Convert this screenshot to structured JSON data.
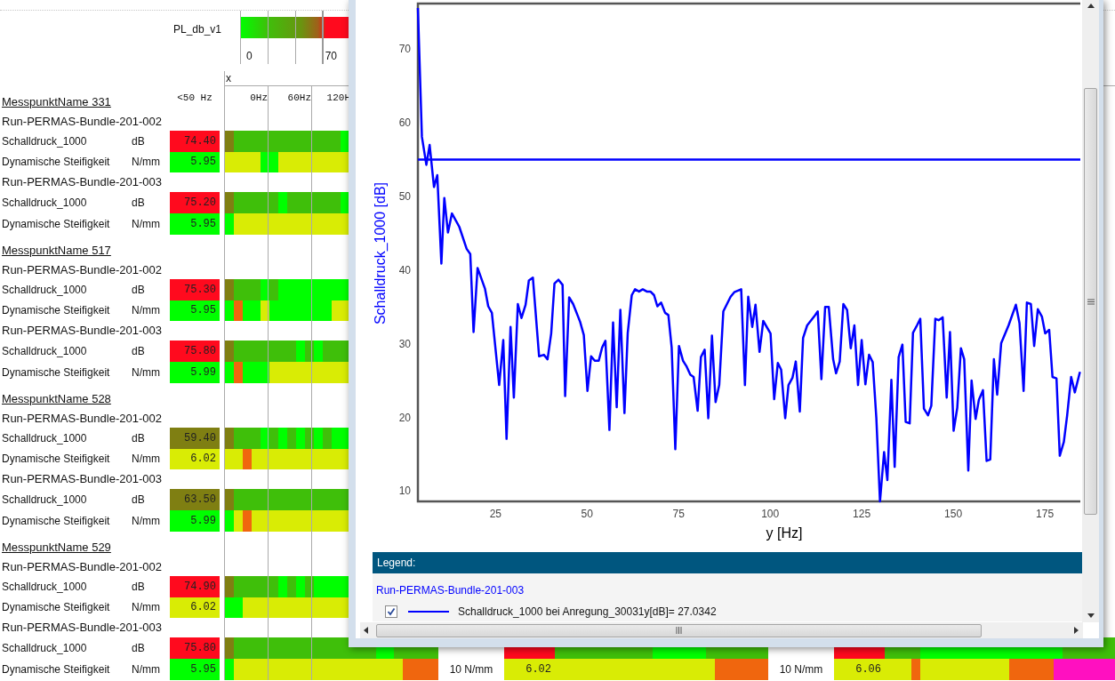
{
  "color_scale": {
    "label": "PL_db_v1",
    "ticks": [
      "0",
      "70"
    ]
  },
  "axis_label": "x",
  "columns": [
    "<50 Hz",
    "0Hz",
    "60Hz",
    "120H"
  ],
  "groups": [
    {
      "title": "MesspunktName 331",
      "runs": [
        {
          "name": "Run-PERMAS-Bundle-201-002",
          "rows": [
            {
              "label": "Schalldruck_1000",
              "unit": "dB",
              "value": "74.40",
              "color": "#ff0a1e",
              "cells": [
                {
                  "color": "#7f7f12"
                },
                {
                  "color": "#3fbf0a"
                },
                {
                  "color": "#3fbf0a"
                },
                {
                  "color": "#3fbf0a"
                },
                {
                  "color": "#3fbf0a"
                },
                {
                  "color": "#3fbf0a"
                },
                {
                  "color": "#3fbf0a"
                },
                {
                  "color": "#3fbf0a"
                },
                {
                  "color": "#3fbf0a"
                },
                {
                  "color": "#3fbf0a"
                },
                {
                  "color": "#3fbf0a"
                },
                {
                  "color": "#3fbf0a"
                },
                {
                  "color": "#3fbf0a"
                },
                {
                  "color": "#00ff00"
                }
              ]
            },
            {
              "label": "Dynamische Steifigkeit",
              "unit": "N/mm",
              "value": "5.95",
              "color": "#00ff00",
              "cells": [
                {
                  "color": "#d9ec05"
                },
                {
                  "color": "#d9ec05"
                },
                {
                  "color": "#d9ec05"
                },
                {
                  "color": "#d9ec05"
                },
                {
                  "color": "#00ff00"
                },
                {
                  "color": "#00ff00"
                },
                {
                  "color": "#d9ec05"
                },
                {
                  "color": "#d9ec05"
                },
                {
                  "color": "#d9ec05"
                },
                {
                  "color": "#d9ec05"
                },
                {
                  "color": "#d9ec05"
                },
                {
                  "color": "#d9ec05"
                },
                {
                  "color": "#d9ec05"
                },
                {
                  "color": "#d9ec05"
                }
              ]
            }
          ]
        },
        {
          "name": "Run-PERMAS-Bundle-201-003",
          "rows": [
            {
              "label": "Schalldruck_1000",
              "unit": "dB",
              "value": "75.20",
              "color": "#ff0a1e",
              "cells": [
                {
                  "color": "#7f7f12"
                },
                {
                  "color": "#3fbf0a"
                },
                {
                  "color": "#3fbf0a"
                },
                {
                  "color": "#3fbf0a"
                },
                {
                  "color": "#3fbf0a"
                },
                {
                  "color": "#3fbf0a"
                },
                {
                  "color": "#00ff00"
                },
                {
                  "color": "#3fbf0a"
                },
                {
                  "color": "#3fbf0a"
                },
                {
                  "color": "#3fbf0a"
                },
                {
                  "color": "#3fbf0a"
                },
                {
                  "color": "#3fbf0a"
                },
                {
                  "color": "#3fbf0a"
                },
                {
                  "color": "#00ff00"
                }
              ]
            },
            {
              "label": "Dynamische Steifigkeit",
              "unit": "N/mm",
              "value": "5.95",
              "color": "#00ff00",
              "cells": [
                {
                  "color": "#00ff00"
                },
                {
                  "color": "#d9ec05"
                },
                {
                  "color": "#d9ec05"
                },
                {
                  "color": "#d9ec05"
                },
                {
                  "color": "#d9ec05"
                },
                {
                  "color": "#d9ec05"
                },
                {
                  "color": "#d9ec05"
                },
                {
                  "color": "#d9ec05"
                },
                {
                  "color": "#d9ec05"
                },
                {
                  "color": "#d9ec05"
                },
                {
                  "color": "#d9ec05"
                },
                {
                  "color": "#d9ec05"
                },
                {
                  "color": "#d9ec05"
                },
                {
                  "color": "#d9ec05"
                }
              ]
            }
          ]
        }
      ]
    },
    {
      "title": "MesspunktName 517",
      "runs": [
        {
          "name": "Run-PERMAS-Bundle-201-002",
          "rows": [
            {
              "label": "Schalldruck_1000",
              "unit": "dB",
              "value": "75.30",
              "color": "#ff0a1e",
              "cells": [
                {
                  "color": "#7f7f12"
                },
                {
                  "color": "#3fbf0a"
                },
                {
                  "color": "#3fbf0a"
                },
                {
                  "color": "#3fbf0a"
                },
                {
                  "color": "#00ff00"
                },
                {
                  "color": "#3fbf0a"
                },
                {
                  "color": "#00ff00"
                },
                {
                  "color": "#00ff00"
                },
                {
                  "color": "#00ff00"
                },
                {
                  "color": "#00ff00"
                },
                {
                  "color": "#00ff00"
                },
                {
                  "color": "#00ff00"
                },
                {
                  "color": "#00ff00"
                },
                {
                  "color": "#00ff00"
                }
              ]
            },
            {
              "label": "Dynamische Steifigkeit",
              "unit": "N/mm",
              "value": "5.95",
              "color": "#00ff00",
              "cells": [
                {
                  "color": "#00ff00"
                },
                {
                  "color": "#f0660e"
                },
                {
                  "color": "#00ff00"
                },
                {
                  "color": "#00ff00"
                },
                {
                  "color": "#d9ec05"
                },
                {
                  "color": "#00ff00"
                },
                {
                  "color": "#00ff00"
                },
                {
                  "color": "#00ff00"
                },
                {
                  "color": "#00ff00"
                },
                {
                  "color": "#00ff00"
                },
                {
                  "color": "#00ff00"
                },
                {
                  "color": "#00ff00"
                },
                {
                  "color": "#d9ec05"
                },
                {
                  "color": "#d9ec05"
                }
              ]
            }
          ]
        },
        {
          "name": "Run-PERMAS-Bundle-201-003",
          "rows": [
            {
              "label": "Schalldruck_1000",
              "unit": "dB",
              "value": "75.80",
              "color": "#ff0a1e",
              "cells": [
                {
                  "color": "#7f7f12"
                },
                {
                  "color": "#3fbf0a"
                },
                {
                  "color": "#3fbf0a"
                },
                {
                  "color": "#3fbf0a"
                },
                {
                  "color": "#3fbf0a"
                },
                {
                  "color": "#3fbf0a"
                },
                {
                  "color": "#3fbf0a"
                },
                {
                  "color": "#3fbf0a"
                },
                {
                  "color": "#00ff00"
                },
                {
                  "color": "#3fbf0a"
                },
                {
                  "color": "#00ff00"
                },
                {
                  "color": "#3fbf0a"
                },
                {
                  "color": "#3fbf0a"
                },
                {
                  "color": "#3fbf0a"
                }
              ]
            },
            {
              "label": "Dynamische Steifigkeit",
              "unit": "N/mm",
              "value": "5.99",
              "color": "#00ff00",
              "cells": [
                {
                  "color": "#00ff00"
                },
                {
                  "color": "#f0660e"
                },
                {
                  "color": "#00ff00"
                },
                {
                  "color": "#00ff00"
                },
                {
                  "color": "#00ff00"
                },
                {
                  "color": "#d9ec05"
                },
                {
                  "color": "#d9ec05"
                },
                {
                  "color": "#d9ec05"
                },
                {
                  "color": "#d9ec05"
                },
                {
                  "color": "#d9ec05"
                },
                {
                  "color": "#d9ec05"
                },
                {
                  "color": "#d9ec05"
                },
                {
                  "color": "#d9ec05"
                },
                {
                  "color": "#d9ec05"
                }
              ]
            }
          ]
        }
      ]
    },
    {
      "title": "MesspunktName 528",
      "runs": [
        {
          "name": "Run-PERMAS-Bundle-201-002",
          "rows": [
            {
              "label": "Schalldruck_1000",
              "unit": "dB",
              "value": "59.40",
              "color": "#7f7f12",
              "cells": [
                {
                  "color": "#7f7f12"
                },
                {
                  "color": "#3fbf0a"
                },
                {
                  "color": "#3fbf0a"
                },
                {
                  "color": "#3fbf0a"
                },
                {
                  "color": "#00ff00"
                },
                {
                  "color": "#3fbf0a"
                },
                {
                  "color": "#00ff00"
                },
                {
                  "color": "#3fbf0a"
                },
                {
                  "color": "#00ff00"
                },
                {
                  "color": "#3fbf0a"
                },
                {
                  "color": "#00ff00"
                },
                {
                  "color": "#3fbf0a"
                },
                {
                  "color": "#00ff00"
                },
                {
                  "color": "#00ff00"
                }
              ]
            },
            {
              "label": "Dynamische Steifigkeit",
              "unit": "N/mm",
              "value": "6.02",
              "color": "#d9ec05",
              "cells": [
                {
                  "color": "#d9ec05"
                },
                {
                  "color": "#d9ec05"
                },
                {
                  "color": "#f0660e"
                },
                {
                  "color": "#d9ec05"
                },
                {
                  "color": "#d9ec05"
                },
                {
                  "color": "#d9ec05"
                },
                {
                  "color": "#d9ec05"
                },
                {
                  "color": "#d9ec05"
                },
                {
                  "color": "#d9ec05"
                },
                {
                  "color": "#d9ec05"
                },
                {
                  "color": "#d9ec05"
                },
                {
                  "color": "#d9ec05"
                },
                {
                  "color": "#d9ec05"
                },
                {
                  "color": "#d9ec05"
                }
              ]
            }
          ]
        },
        {
          "name": "Run-PERMAS-Bundle-201-003",
          "rows": [
            {
              "label": "Schalldruck_1000",
              "unit": "dB",
              "value": "63.50",
              "color": "#7f7f12",
              "cells": [
                {
                  "color": "#7f7f12"
                },
                {
                  "color": "#3fbf0a"
                },
                {
                  "color": "#3fbf0a"
                },
                {
                  "color": "#3fbf0a"
                },
                {
                  "color": "#3fbf0a"
                },
                {
                  "color": "#3fbf0a"
                },
                {
                  "color": "#3fbf0a"
                },
                {
                  "color": "#3fbf0a"
                },
                {
                  "color": "#3fbf0a"
                },
                {
                  "color": "#3fbf0a"
                },
                {
                  "color": "#3fbf0a"
                },
                {
                  "color": "#3fbf0a"
                },
                {
                  "color": "#3fbf0a"
                },
                {
                  "color": "#3fbf0a"
                }
              ]
            },
            {
              "label": "Dynamische Steifigkeit",
              "unit": "N/mm",
              "value": "5.99",
              "color": "#00ff00",
              "cells": [
                {
                  "color": "#00ff00"
                },
                {
                  "color": "#d9ec05"
                },
                {
                  "color": "#f0660e"
                },
                {
                  "color": "#d9ec05"
                },
                {
                  "color": "#d9ec05"
                },
                {
                  "color": "#d9ec05"
                },
                {
                  "color": "#d9ec05"
                },
                {
                  "color": "#d9ec05"
                },
                {
                  "color": "#d9ec05"
                },
                {
                  "color": "#d9ec05"
                },
                {
                  "color": "#d9ec05"
                },
                {
                  "color": "#d9ec05"
                },
                {
                  "color": "#d9ec05"
                },
                {
                  "color": "#d9ec05"
                }
              ]
            }
          ]
        }
      ]
    },
    {
      "title": "MesspunktName 529",
      "runs": [
        {
          "name": "Run-PERMAS-Bundle-201-002",
          "rows": [
            {
              "label": "Schalldruck_1000",
              "unit": "dB",
              "value": "74.90",
              "color": "#ff0a1e",
              "cells": [
                {
                  "color": "#7f7f12"
                },
                {
                  "color": "#3fbf0a"
                },
                {
                  "color": "#3fbf0a"
                },
                {
                  "color": "#3fbf0a"
                },
                {
                  "color": "#3fbf0a"
                },
                {
                  "color": "#3fbf0a"
                },
                {
                  "color": "#00ff00"
                },
                {
                  "color": "#3fbf0a"
                },
                {
                  "color": "#00ff00"
                },
                {
                  "color": "#3fbf0a"
                },
                {
                  "color": "#00ff00"
                },
                {
                  "color": "#00ff00"
                },
                {
                  "color": "#00ff00"
                },
                {
                  "color": "#00ff00"
                }
              ]
            },
            {
              "label": "Dynamische Steifigkeit",
              "unit": "N/mm",
              "value": "6.02",
              "color": "#d9ec05",
              "cells": [
                {
                  "color": "#00ff00"
                },
                {
                  "color": "#00ff00"
                },
                {
                  "color": "#d9ec05"
                },
                {
                  "color": "#d9ec05"
                },
                {
                  "color": "#d9ec05"
                },
                {
                  "color": "#d9ec05"
                },
                {
                  "color": "#d9ec05"
                },
                {
                  "color": "#d9ec05"
                },
                {
                  "color": "#d9ec05"
                },
                {
                  "color": "#d9ec05"
                },
                {
                  "color": "#d9ec05"
                },
                {
                  "color": "#d9ec05"
                },
                {
                  "color": "#d9ec05"
                },
                {
                  "color": "#d9ec05"
                }
              ]
            }
          ]
        },
        {
          "name": "Run-PERMAS-Bundle-201-003",
          "rows": [
            {
              "label": "Schalldruck_1000",
              "unit": "dB",
              "value": "75.80",
              "color": "#ff0a1e",
              "cells": [
                {
                  "color": "#7f7f12"
                },
                {
                  "color": "#3fbf0a"
                },
                {
                  "color": "#3fbf0a"
                },
                {
                  "color": "#3fbf0a"
                },
                {
                  "color": "#3fbf0a"
                },
                {
                  "color": "#3fbf0a"
                },
                {
                  "color": "#3fbf0a"
                },
                {
                  "color": "#3fbf0a"
                },
                {
                  "color": "#3fbf0a"
                },
                {
                  "color": "#3fbf0a"
                },
                {
                  "color": "#3fbf0a"
                },
                {
                  "color": "#3fbf0a"
                },
                {
                  "color": "#3fbf0a"
                },
                {
                  "color": "#3fbf0a"
                },
                {
                  "color": "#3fbf0a"
                },
                {
                  "color": "#3fbf0a"
                },
                {
                  "color": "#3fbf0a"
                },
                {
                  "color": "#00ff00"
                },
                {
                  "color": "#00ff00"
                },
                {
                  "color": "#3fbf0a"
                },
                {
                  "color": "#3fbf0a"
                },
                {
                  "color": "#3fbf0a"
                },
                {
                  "color": "#3fbf0a"
                },
                {
                  "color": "#3fbf0a"
                }
              ],
              "more": [
                {
                  "color": "#ff0a1e",
                  "cells": [
                    {
                      "color": "#3fbf0a"
                    },
                    {
                      "color": "#3fbf0a"
                    },
                    {
                      "color": "#3fbf0a"
                    },
                    {
                      "color": "#3fbf0a"
                    },
                    {
                      "color": "#3fbf0a"
                    },
                    {
                      "color": "#3fbf0a"
                    },
                    {
                      "color": "#3fbf0a"
                    },
                    {
                      "color": "#3fbf0a"
                    },
                    {
                      "color": "#3fbf0a"
                    },
                    {
                      "color": "#3fbf0a"
                    },
                    {
                      "color": "#3fbf0a"
                    },
                    {
                      "color": "#00ff00"
                    },
                    {
                      "color": "#00ff00"
                    },
                    {
                      "color": "#00ff00"
                    },
                    {
                      "color": "#00ff00"
                    },
                    {
                      "color": "#00ff00"
                    },
                    {
                      "color": "#00ff00"
                    },
                    {
                      "color": "#3fbf0a"
                    },
                    {
                      "color": "#3fbf0a"
                    },
                    {
                      "color": "#3fbf0a"
                    },
                    {
                      "color": "#3fbf0a"
                    },
                    {
                      "color": "#3fbf0a"
                    },
                    {
                      "color": "#3fbf0a"
                    },
                    {
                      "color": "#3fbf0a"
                    }
                  ]
                },
                {
                  "color": "#ff0a1e",
                  "cells": [
                    {
                      "color": "#3fbf0a"
                    },
                    {
                      "color": "#3fbf0a"
                    },
                    {
                      "color": "#3fbf0a"
                    },
                    {
                      "color": "#3fbf0a"
                    },
                    {
                      "color": "#00ff00"
                    },
                    {
                      "color": "#00ff00"
                    },
                    {
                      "color": "#00ff00"
                    },
                    {
                      "color": "#00ff00"
                    },
                    {
                      "color": "#00ff00"
                    },
                    {
                      "color": "#00ff00"
                    },
                    {
                      "color": "#00ff00"
                    },
                    {
                      "color": "#00ff00"
                    },
                    {
                      "color": "#00ff00"
                    },
                    {
                      "color": "#00ff00"
                    },
                    {
                      "color": "#00ff00"
                    },
                    {
                      "color": "#00ff00"
                    },
                    {
                      "color": "#00ff00"
                    },
                    {
                      "color": "#00ff00"
                    },
                    {
                      "color": "#00ff00"
                    },
                    {
                      "color": "#00ff00"
                    },
                    {
                      "color": "#3fbf0a"
                    },
                    {
                      "color": "#3fbf0a"
                    },
                    {
                      "color": "#3fbf0a"
                    },
                    {
                      "color": "#3fbf0a"
                    },
                    {
                      "color": "#3fbf0a"
                    },
                    {
                      "color": "#3fbf0a"
                    }
                  ]
                }
              ]
            },
            {
              "label": "Dynamische Steifigkeit",
              "unit": "N/mm",
              "value": "5.95",
              "color": "#00ff00",
              "cells": [
                {
                  "color": "#00ff00"
                },
                {
                  "color": "#d9ec05"
                },
                {
                  "color": "#d9ec05"
                },
                {
                  "color": "#d9ec05"
                },
                {
                  "color": "#d9ec05"
                },
                {
                  "color": "#d9ec05"
                },
                {
                  "color": "#d9ec05"
                },
                {
                  "color": "#d9ec05"
                },
                {
                  "color": "#d9ec05"
                },
                {
                  "color": "#d9ec05"
                },
                {
                  "color": "#d9ec05"
                },
                {
                  "color": "#d9ec05"
                },
                {
                  "color": "#d9ec05"
                },
                {
                  "color": "#d9ec05"
                },
                {
                  "color": "#d9ec05"
                },
                {
                  "color": "#d9ec05"
                },
                {
                  "color": "#d9ec05"
                },
                {
                  "color": "#d9ec05"
                },
                {
                  "color": "#d9ec05"
                },
                {
                  "color": "#d9ec05"
                },
                {
                  "color": "#f0660e"
                },
                {
                  "color": "#f0660e"
                },
                {
                  "color": "#f0660e"
                },
                {
                  "color": "#f0660e"
                }
              ],
              "more": [
                {
                  "unit": "10 N/mm",
                  "value": "6.02",
                  "color": "#d9ec05",
                  "cells": [
                    {
                      "color": "#d9ec05"
                    },
                    {
                      "color": "#d9ec05"
                    },
                    {
                      "color": "#d9ec05"
                    },
                    {
                      "color": "#d9ec05"
                    },
                    {
                      "color": "#d9ec05"
                    },
                    {
                      "color": "#d9ec05"
                    },
                    {
                      "color": "#d9ec05"
                    },
                    {
                      "color": "#d9ec05"
                    },
                    {
                      "color": "#d9ec05"
                    },
                    {
                      "color": "#d9ec05"
                    },
                    {
                      "color": "#d9ec05"
                    },
                    {
                      "color": "#d9ec05"
                    },
                    {
                      "color": "#d9ec05"
                    },
                    {
                      "color": "#d9ec05"
                    },
                    {
                      "color": "#d9ec05"
                    },
                    {
                      "color": "#d9ec05"
                    },
                    {
                      "color": "#d9ec05"
                    },
                    {
                      "color": "#d9ec05"
                    },
                    {
                      "color": "#f0660e"
                    },
                    {
                      "color": "#f0660e"
                    },
                    {
                      "color": "#f0660e"
                    },
                    {
                      "color": "#f0660e"
                    },
                    {
                      "color": "#f0660e"
                    },
                    {
                      "color": "#f0660e"
                    }
                  ]
                },
                {
                  "unit": "10 N/mm",
                  "value": "6.06",
                  "color": "#d9ec05",
                  "cells": [
                    {
                      "color": "#d9ec05"
                    },
                    {
                      "color": "#d9ec05"
                    },
                    {
                      "color": "#d9ec05"
                    },
                    {
                      "color": "#f0660e"
                    },
                    {
                      "color": "#d9ec05"
                    },
                    {
                      "color": "#d9ec05"
                    },
                    {
                      "color": "#d9ec05"
                    },
                    {
                      "color": "#d9ec05"
                    },
                    {
                      "color": "#d9ec05"
                    },
                    {
                      "color": "#d9ec05"
                    },
                    {
                      "color": "#d9ec05"
                    },
                    {
                      "color": "#d9ec05"
                    },
                    {
                      "color": "#d9ec05"
                    },
                    {
                      "color": "#d9ec05"
                    },
                    {
                      "color": "#f0660e"
                    },
                    {
                      "color": "#f0660e"
                    },
                    {
                      "color": "#f0660e"
                    },
                    {
                      "color": "#f0660e"
                    },
                    {
                      "color": "#f0660e"
                    },
                    {
                      "color": "#ff10c0"
                    },
                    {
                      "color": "#ff10c0"
                    },
                    {
                      "color": "#ff10c0"
                    },
                    {
                      "color": "#ff10c0"
                    },
                    {
                      "color": "#ff10c0"
                    },
                    {
                      "color": "#ff10c0"
                    },
                    {
                      "color": "#ff10c0"
                    }
                  ]
                }
              ]
            }
          ]
        }
      ]
    }
  ],
  "chart_window": {
    "chart_data": {
      "type": "line",
      "xlabel": "y [Hz]",
      "ylabel": "Schalldruck_1000 [dB]",
      "xlim": [
        3.8,
        184.7
      ],
      "ylim": [
        8.6,
        76.2
      ],
      "xticks": [
        25,
        50,
        75,
        100,
        125,
        150,
        175
      ],
      "yticks": [
        10,
        20,
        30,
        40,
        50,
        60,
        70
      ],
      "x": [
        3.8,
        4.9,
        6.1,
        7,
        8.2,
        9.1,
        10.2,
        11,
        12,
        13.1,
        15.1,
        17.1,
        18.1,
        19,
        20.1,
        22.1,
        23,
        24,
        26,
        27.1,
        28,
        29.1,
        30,
        31.1,
        32.1,
        33.2,
        34.1,
        35.2,
        36.9,
        38.2,
        39.2,
        40.2,
        41.1,
        42.2,
        43.3,
        44,
        45.1,
        46.2,
        48.1,
        49.1,
        50.1,
        51.1,
        52.1,
        53.2,
        54.1,
        55,
        56.1,
        57.1,
        58.1,
        59.1,
        60.2,
        61.1,
        62.2,
        63.1,
        64.2,
        65.2,
        66.3,
        67.3,
        68.3,
        69.2,
        70.2,
        71.3,
        72.2,
        73.1,
        74.1,
        75.1,
        76.2,
        77.2,
        78.2,
        79.1,
        80.2,
        81.1,
        82.1,
        83.1,
        84.1,
        85.1,
        86.1,
        87.2,
        88.2,
        89.2,
        90.2,
        92.1,
        93.1,
        94,
        95.1,
        96,
        97.1,
        98.1,
        100.1,
        101.1,
        102.1,
        103,
        104.1,
        105,
        106.1,
        107,
        108.1,
        109,
        110.1,
        112,
        113,
        114,
        115,
        116,
        117.2,
        118,
        119,
        120,
        121,
        122,
        123,
        124,
        125,
        126,
        127,
        128,
        129,
        130,
        131.1,
        132,
        133.1,
        134,
        135.1,
        136.1,
        137,
        138.1,
        139,
        140.1,
        141,
        142,
        143.1,
        144,
        145.1,
        146,
        147.1,
        148.2,
        149.1,
        150.1,
        151.1,
        152.1,
        153,
        154.1,
        155,
        156.1,
        157,
        158.1,
        159.1,
        160.1,
        161.1,
        162,
        163.1,
        165.1,
        167.1,
        168.1,
        169.2,
        170.1,
        171.2,
        172.1,
        173.1,
        174.2,
        175.1,
        176.2,
        177.1,
        178.2,
        179.1,
        180.2,
        181.1,
        182.2,
        183.2,
        184.6
      ],
      "series": [
        {
          "name": "Schalldruck_1000 bei Anregung_30031y[dB]= 27.0342",
          "color": "#0000ff",
          "values": [
            75.6,
            58.1,
            54.3,
            57,
            51.3,
            52.9,
            40.9,
            49.8,
            45.1,
            47.7,
            45.9,
            42.9,
            42.2,
            31.6,
            40.3,
            37.5,
            35.1,
            34.2,
            24.4,
            30.5,
            17.1,
            32.3,
            22.7,
            35.4,
            33.5,
            35.3,
            38.6,
            39,
            28.3,
            28.5,
            27.9,
            31.4,
            38.2,
            38.7,
            38,
            22.9,
            36.3,
            35.4,
            33,
            31.2,
            23.6,
            28.3,
            27.7,
            27.7,
            29.5,
            30.4,
            18.3,
            32.9,
            21.4,
            34.6,
            20.6,
            31.5,
            36.6,
            37.4,
            37.1,
            37.4,
            37.1,
            37.1,
            36.6,
            35.1,
            35.6,
            34.2,
            33.9,
            29.5,
            15.7,
            29.7,
            27.7,
            26.9,
            25.8,
            25.5,
            20.9,
            28.2,
            29.2,
            19.9,
            31.1,
            22.1,
            24.4,
            34.4,
            35.4,
            36.4,
            37,
            37.4,
            24.4,
            36.4,
            32.3,
            35.3,
            28.9,
            33.1,
            31.4,
            22.5,
            27.4,
            26.5,
            19.9,
            24.4,
            25.4,
            27.6,
            20.8,
            30.8,
            32.5,
            33.7,
            34.4,
            25.2,
            35,
            35,
            27.9,
            26,
            27.6,
            35.4,
            34.6,
            29.4,
            32.5,
            24.4,
            30.5,
            24.5,
            28.5,
            27.5,
            19.9,
            8.6,
            15.3,
            11.5,
            25.1,
            13.3,
            28.2,
            29.9,
            19.4,
            19.2,
            31.5,
            32.5,
            33.4,
            21.2,
            20.3,
            21.6,
            33.4,
            33.2,
            33.6,
            22.7,
            31.6,
            18.2,
            21.3,
            29.4,
            27.9,
            12.8,
            25,
            19.8,
            22.4,
            23.7,
            14.1,
            14.3,
            27.9,
            23.1,
            30.1,
            32.5,
            35.3,
            32.8,
            23.6,
            35.6,
            35.4,
            29.7,
            34.7,
            33.7,
            31.4,
            31.9,
            25.5,
            25.3,
            14.8,
            16.7,
            20.3,
            25.5,
            23.4,
            26.2
          ]
        }
      ],
      "ref_lines": [
        {
          "axis": "y",
          "value": 55,
          "color": "#0000ff"
        }
      ]
    },
    "legend": {
      "title": "Legend:",
      "group": "Run-PERMAS-Bundle-201-003",
      "entries": [
        {
          "checked": true
        }
      ]
    }
  }
}
